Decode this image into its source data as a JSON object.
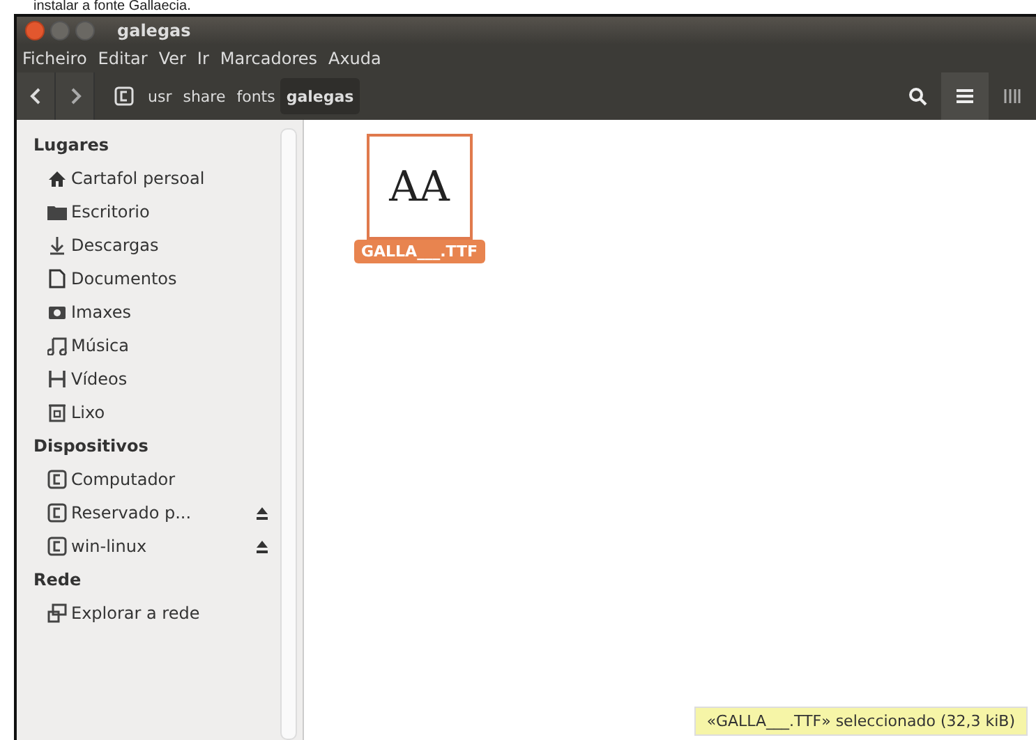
{
  "caption": "instalar a fonte Gallaecia.",
  "window": {
    "title": "galegas"
  },
  "menu": [
    "Ficheiro",
    "Editar",
    "Ver",
    "Ir",
    "Marcadores",
    "Axuda"
  ],
  "path": [
    {
      "label": "usr",
      "selected": false
    },
    {
      "label": "share",
      "selected": false
    },
    {
      "label": "fonts",
      "selected": false
    },
    {
      "label": "galegas",
      "selected": true
    }
  ],
  "view_buttons": [
    {
      "kind": "search",
      "selected": false
    },
    {
      "kind": "list",
      "selected": true
    },
    {
      "kind": "grid",
      "selected": false
    }
  ],
  "sidebar": {
    "sections": [
      {
        "title": "Lugares",
        "items": [
          {
            "kind": "home",
            "label": "Cartafol persoal",
            "eject": false
          },
          {
            "kind": "folder",
            "label": "Escritorio",
            "eject": false
          },
          {
            "kind": "download",
            "label": "Descargas",
            "eject": false
          },
          {
            "kind": "document",
            "label": "Documentos",
            "eject": false
          },
          {
            "kind": "camera",
            "label": "Imaxes",
            "eject": false
          },
          {
            "kind": "music",
            "label": "Música",
            "eject": false
          },
          {
            "kind": "video",
            "label": "Vídeos",
            "eject": false
          },
          {
            "kind": "trash",
            "label": "Lixo",
            "eject": false
          }
        ]
      },
      {
        "title": "Dispositivos",
        "items": [
          {
            "kind": "drive",
            "label": "Computador",
            "eject": false
          },
          {
            "kind": "drive",
            "label": "Reservado p...",
            "eject": true
          },
          {
            "kind": "drive",
            "label": "win-linux",
            "eject": true
          }
        ]
      },
      {
        "title": "Rede",
        "items": [
          {
            "kind": "network",
            "label": "Explorar a rede",
            "eject": false
          }
        ]
      }
    ]
  },
  "files": [
    {
      "preview": "AA",
      "name": "GALLA___.TTF",
      "selected": true
    }
  ],
  "status_bar": "«GALLA___.TTF» seleccionado  (32,3 kiB)"
}
